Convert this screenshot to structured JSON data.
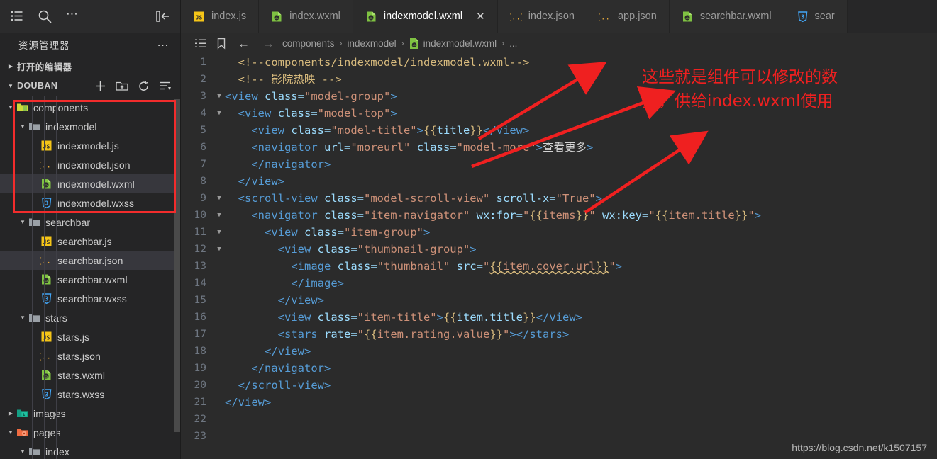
{
  "sidebar": {
    "toolbar_icons": [
      "list-icon",
      "search-icon",
      "ellipsis-icon",
      "collapse-panel-icon"
    ],
    "title": "资源管理器",
    "title_more": "…",
    "open_editors_label": "打开的编辑器",
    "project_label": "DOUBAN",
    "project_actions": [
      "new-file-icon",
      "new-folder-icon",
      "refresh-icon",
      "collapse-all-icon"
    ],
    "tree": [
      {
        "label": "components",
        "depth": 1,
        "type": "folder-component",
        "state": "open",
        "selected": false
      },
      {
        "label": "indexmodel",
        "depth": 2,
        "type": "folder",
        "state": "open",
        "selected": false
      },
      {
        "label": "indexmodel.js",
        "depth": 3,
        "type": "js",
        "state": "",
        "selected": false
      },
      {
        "label": "indexmodel.json",
        "depth": 3,
        "type": "json",
        "state": "",
        "selected": false
      },
      {
        "label": "indexmodel.wxml",
        "depth": 3,
        "type": "wxml",
        "state": "",
        "selected": true
      },
      {
        "label": "indexmodel.wxss",
        "depth": 3,
        "type": "wxss",
        "state": "",
        "selected": false
      },
      {
        "label": "searchbar",
        "depth": 2,
        "type": "folder",
        "state": "open",
        "selected": false
      },
      {
        "label": "searchbar.js",
        "depth": 3,
        "type": "js",
        "state": "",
        "selected": false
      },
      {
        "label": "searchbar.json",
        "depth": 3,
        "type": "json",
        "state": "",
        "selected": true
      },
      {
        "label": "searchbar.wxml",
        "depth": 3,
        "type": "wxml",
        "state": "",
        "selected": false
      },
      {
        "label": "searchbar.wxss",
        "depth": 3,
        "type": "wxss",
        "state": "",
        "selected": false
      },
      {
        "label": "stars",
        "depth": 2,
        "type": "folder",
        "state": "open",
        "selected": false
      },
      {
        "label": "stars.js",
        "depth": 3,
        "type": "js",
        "state": "",
        "selected": false
      },
      {
        "label": "stars.json",
        "depth": 3,
        "type": "json",
        "state": "",
        "selected": false
      },
      {
        "label": "stars.wxml",
        "depth": 3,
        "type": "wxml",
        "state": "",
        "selected": false
      },
      {
        "label": "stars.wxss",
        "depth": 3,
        "type": "wxss",
        "state": "",
        "selected": false
      },
      {
        "label": "images",
        "depth": 1,
        "type": "folder-images",
        "state": "closed",
        "selected": false
      },
      {
        "label": "pages",
        "depth": 1,
        "type": "folder-pages",
        "state": "open",
        "selected": false
      },
      {
        "label": "index",
        "depth": 2,
        "type": "folder",
        "state": "open",
        "selected": false
      }
    ]
  },
  "tabs": [
    {
      "label": "index.js",
      "type": "js",
      "active": false,
      "closable": false
    },
    {
      "label": "index.wxml",
      "type": "wxml",
      "active": false,
      "closable": false
    },
    {
      "label": "indexmodel.wxml",
      "type": "wxml",
      "active": true,
      "closable": true,
      "close": "✕"
    },
    {
      "label": "index.json",
      "type": "json",
      "active": false,
      "closable": false
    },
    {
      "label": "app.json",
      "type": "json",
      "active": false,
      "closable": false
    },
    {
      "label": "searchbar.wxml",
      "type": "wxml",
      "active": false,
      "closable": false
    },
    {
      "label": "sear",
      "type": "wxss",
      "active": false,
      "closable": false
    }
  ],
  "breadcrumb": {
    "icons": [
      "outline-icon",
      "bookmark-icon"
    ],
    "back_arrow": "←",
    "forward_arrow": "→",
    "crumbs": [
      "components",
      "indexmodel",
      "indexmodel.wxml",
      "..."
    ],
    "separator": "›"
  },
  "code": {
    "lines": [
      {
        "n": 1,
        "fold": "",
        "highlight": false,
        "tokens": [
          {
            "t": "  ",
            "c": "c-white"
          },
          {
            "t": "<!--components/indexmodel/indexmodel.wxml-->",
            "c": "c-comy"
          }
        ]
      },
      {
        "n": 2,
        "fold": "",
        "highlight": false,
        "tokens": [
          {
            "t": "  ",
            "c": "c-white"
          },
          {
            "t": "<!-- 影院热映 -->",
            "c": "c-comy"
          }
        ]
      },
      {
        "n": 3,
        "fold": "v",
        "highlight": false,
        "tokens": [
          {
            "t": "",
            "c": "c-white"
          },
          {
            "t": "<view",
            "c": "c-tag"
          },
          {
            "t": " class=",
            "c": "c-attr"
          },
          {
            "t": "\"model-group\"",
            "c": "c-str"
          },
          {
            "t": ">",
            "c": "c-tag"
          }
        ]
      },
      {
        "n": 4,
        "fold": "v",
        "highlight": false,
        "tokens": [
          {
            "t": "  ",
            "c": "c-white"
          },
          {
            "t": "<view",
            "c": "c-tag"
          },
          {
            "t": " class=",
            "c": "c-attr"
          },
          {
            "t": "\"model-top\"",
            "c": "c-str"
          },
          {
            "t": ">",
            "c": "c-tag"
          }
        ]
      },
      {
        "n": 5,
        "fold": "",
        "highlight": false,
        "tokens": [
          {
            "t": "    ",
            "c": "c-white"
          },
          {
            "t": "<view",
            "c": "c-tag"
          },
          {
            "t": " class=",
            "c": "c-attr"
          },
          {
            "t": "\"model-title\"",
            "c": "c-str"
          },
          {
            "t": ">",
            "c": "c-tag"
          },
          {
            "t": "{{",
            "c": "c-brace"
          },
          {
            "t": "title",
            "c": "c-attr"
          },
          {
            "t": "}}",
            "c": "c-brace"
          },
          {
            "t": "</view>",
            "c": "c-tag"
          }
        ]
      },
      {
        "n": 6,
        "fold": "",
        "highlight": false,
        "tokens": [
          {
            "t": "    ",
            "c": "c-white"
          },
          {
            "t": "<navigator",
            "c": "c-tag"
          },
          {
            "t": " url=",
            "c": "c-attr"
          },
          {
            "t": "\"moreurl\"",
            "c": "c-str"
          },
          {
            "t": " class=",
            "c": "c-attr"
          },
          {
            "t": "\"model-more\"",
            "c": "c-str"
          },
          {
            "t": ">",
            "c": "c-tag"
          },
          {
            "t": "查看更多",
            "c": "c-white"
          },
          {
            "t": ">",
            "c": "c-tag"
          }
        ]
      },
      {
        "n": 7,
        "fold": "",
        "highlight": false,
        "tokens": [
          {
            "t": "    ",
            "c": "c-white"
          },
          {
            "t": "</navigator>",
            "c": "c-tag"
          }
        ]
      },
      {
        "n": 8,
        "fold": "",
        "highlight": false,
        "tokens": [
          {
            "t": "  ",
            "c": "c-white"
          },
          {
            "t": "</view>",
            "c": "c-tag"
          }
        ]
      },
      {
        "n": 9,
        "fold": "v",
        "highlight": false,
        "tokens": [
          {
            "t": "  ",
            "c": "c-white"
          },
          {
            "t": "<scroll-view",
            "c": "c-tag"
          },
          {
            "t": " class=",
            "c": "c-attr"
          },
          {
            "t": "\"model-scroll-view\"",
            "c": "c-str"
          },
          {
            "t": " scroll-x=",
            "c": "c-attr"
          },
          {
            "t": "\"True\"",
            "c": "c-str"
          },
          {
            "t": ">",
            "c": "c-tag"
          }
        ]
      },
      {
        "n": 10,
        "fold": "v",
        "highlight": false,
        "tokens": [
          {
            "t": "    ",
            "c": "c-white"
          },
          {
            "t": "<navigator",
            "c": "c-tag"
          },
          {
            "t": " class=",
            "c": "c-attr"
          },
          {
            "t": "\"item-navigator\"",
            "c": "c-str"
          },
          {
            "t": " wx:for=",
            "c": "c-attr"
          },
          {
            "t": "\"",
            "c": "c-str"
          },
          {
            "t": "{{",
            "c": "c-brace"
          },
          {
            "t": "items",
            "c": "c-str"
          },
          {
            "t": "}}",
            "c": "c-brace"
          },
          {
            "t": "\"",
            "c": "c-str"
          },
          {
            "t": " wx:key=",
            "c": "c-attr"
          },
          {
            "t": "\"",
            "c": "c-str"
          },
          {
            "t": "{{",
            "c": "c-brace"
          },
          {
            "t": "item.title",
            "c": "c-str"
          },
          {
            "t": "}}",
            "c": "c-brace"
          },
          {
            "t": "\"",
            "c": "c-str"
          },
          {
            "t": ">",
            "c": "c-tag"
          }
        ]
      },
      {
        "n": 11,
        "fold": "v",
        "highlight": false,
        "tokens": [
          {
            "t": "      ",
            "c": "c-white"
          },
          {
            "t": "<view",
            "c": "c-tag"
          },
          {
            "t": " class=",
            "c": "c-attr"
          },
          {
            "t": "\"item-group\"",
            "c": "c-str"
          },
          {
            "t": ">",
            "c": "c-tag"
          }
        ]
      },
      {
        "n": 12,
        "fold": "v",
        "highlight": false,
        "tokens": [
          {
            "t": "        ",
            "c": "c-white"
          },
          {
            "t": "<view",
            "c": "c-tag"
          },
          {
            "t": " class=",
            "c": "c-attr"
          },
          {
            "t": "\"thumbnail-group\"",
            "c": "c-str"
          },
          {
            "t": ">",
            "c": "c-tag"
          }
        ]
      },
      {
        "n": 13,
        "fold": "",
        "highlight": false,
        "tokens": [
          {
            "t": "          ",
            "c": "c-white"
          },
          {
            "t": "<image",
            "c": "c-tag"
          },
          {
            "t": " class=",
            "c": "c-attr"
          },
          {
            "t": "\"thumbnail\"",
            "c": "c-str"
          },
          {
            "t": " src=",
            "c": "c-attr"
          },
          {
            "t": "\"",
            "c": "c-str"
          },
          {
            "t": "{{",
            "c": "c-brace squiggle"
          },
          {
            "t": "item.cover.url",
            "c": "c-str squiggle"
          },
          {
            "t": "}}",
            "c": "c-brace squiggle"
          },
          {
            "t": "\"",
            "c": "c-str"
          },
          {
            "t": ">",
            "c": "c-tag"
          }
        ]
      },
      {
        "n": 14,
        "fold": "",
        "highlight": false,
        "tokens": [
          {
            "t": "          ",
            "c": "c-white"
          },
          {
            "t": "</image>",
            "c": "c-tag"
          }
        ]
      },
      {
        "n": 15,
        "fold": "",
        "highlight": false,
        "tokens": [
          {
            "t": "        ",
            "c": "c-white"
          },
          {
            "t": "</view>",
            "c": "c-tag"
          }
        ]
      },
      {
        "n": 16,
        "fold": "",
        "highlight": false,
        "tokens": [
          {
            "t": "        ",
            "c": "c-white"
          },
          {
            "t": "<view",
            "c": "c-tag"
          },
          {
            "t": " class=",
            "c": "c-attr"
          },
          {
            "t": "\"item-title\"",
            "c": "c-str"
          },
          {
            "t": ">",
            "c": "c-tag"
          },
          {
            "t": "{{",
            "c": "c-brace"
          },
          {
            "t": "item.title",
            "c": "c-attr"
          },
          {
            "t": "}}",
            "c": "c-brace"
          },
          {
            "t": "</view>",
            "c": "c-tag"
          }
        ]
      },
      {
        "n": 17,
        "fold": "",
        "highlight": false,
        "tokens": [
          {
            "t": "        ",
            "c": "c-white"
          },
          {
            "t": "<stars",
            "c": "c-tag"
          },
          {
            "t": " rate=",
            "c": "c-attr"
          },
          {
            "t": "\"",
            "c": "c-str"
          },
          {
            "t": "{{",
            "c": "c-brace"
          },
          {
            "t": "item.rating.value",
            "c": "c-str"
          },
          {
            "t": "}}",
            "c": "c-brace"
          },
          {
            "t": "\"",
            "c": "c-str"
          },
          {
            "t": ">",
            "c": "c-tag"
          },
          {
            "t": "</stars>",
            "c": "c-tag"
          }
        ]
      },
      {
        "n": 18,
        "fold": "",
        "highlight": false,
        "tokens": [
          {
            "t": "      ",
            "c": "c-white"
          },
          {
            "t": "</view>",
            "c": "c-tag"
          }
        ]
      },
      {
        "n": 19,
        "fold": "",
        "highlight": false,
        "tokens": [
          {
            "t": "    ",
            "c": "c-white"
          },
          {
            "t": "</navigator>",
            "c": "c-tag"
          }
        ]
      },
      {
        "n": 20,
        "fold": "",
        "highlight": false,
        "tokens": [
          {
            "t": "  ",
            "c": "c-white"
          },
          {
            "t": "</scroll-view>",
            "c": "c-tag"
          }
        ]
      },
      {
        "n": 21,
        "fold": "",
        "highlight": false,
        "tokens": [
          {
            "t": "",
            "c": "c-white"
          },
          {
            "t": "</view>",
            "c": "c-tag"
          }
        ]
      },
      {
        "n": 22,
        "fold": "",
        "highlight": false,
        "tokens": []
      },
      {
        "n": 23,
        "fold": "",
        "highlight": true,
        "tokens": []
      }
    ]
  },
  "annotations": {
    "note_line1": "这些就是组件可以修改的数",
    "note_line2": "据，供给index.wxml使用",
    "color": "#ef2020",
    "arrow_count": 3
  },
  "watermark": "https://blog.csdn.net/k1507157",
  "colors": {
    "accent_red": "#f22c2c",
    "sidebar_bg": "#252526",
    "editor_bg": "#2b2b2b",
    "selection": "#37373d"
  }
}
